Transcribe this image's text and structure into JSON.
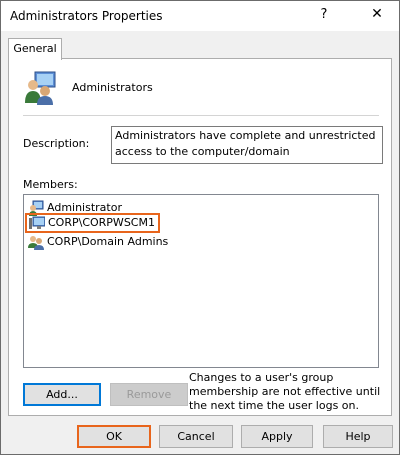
{
  "window": {
    "title": "Administrators Properties",
    "help_label": "?",
    "close_label": "✕"
  },
  "tabs": [
    {
      "label": "General"
    }
  ],
  "group": {
    "name": "Administrators",
    "icon": "users-group-icon"
  },
  "description": {
    "label": "Description:",
    "value": "Administrators have complete and unrestricted access to the computer/domain"
  },
  "members": {
    "label": "Members:",
    "items": [
      {
        "name": "Administrator",
        "icon": "user-icon"
      },
      {
        "name": "CORP\\CORPWSCM1",
        "icon": "computer-icon",
        "highlighted": true
      },
      {
        "name": "CORP\\Domain Admins",
        "icon": "users-group-icon"
      }
    ]
  },
  "actions": {
    "add_label": "Add...",
    "remove_label": "Remove",
    "note": "Changes to a user's group membership are not effective until the next time the user logs on."
  },
  "footer": {
    "ok_label": "OK",
    "cancel_label": "Cancel",
    "apply_label": "Apply",
    "help_label": "Help"
  },
  "colors": {
    "highlight": "#e8651c",
    "accent": "#0078d7"
  }
}
